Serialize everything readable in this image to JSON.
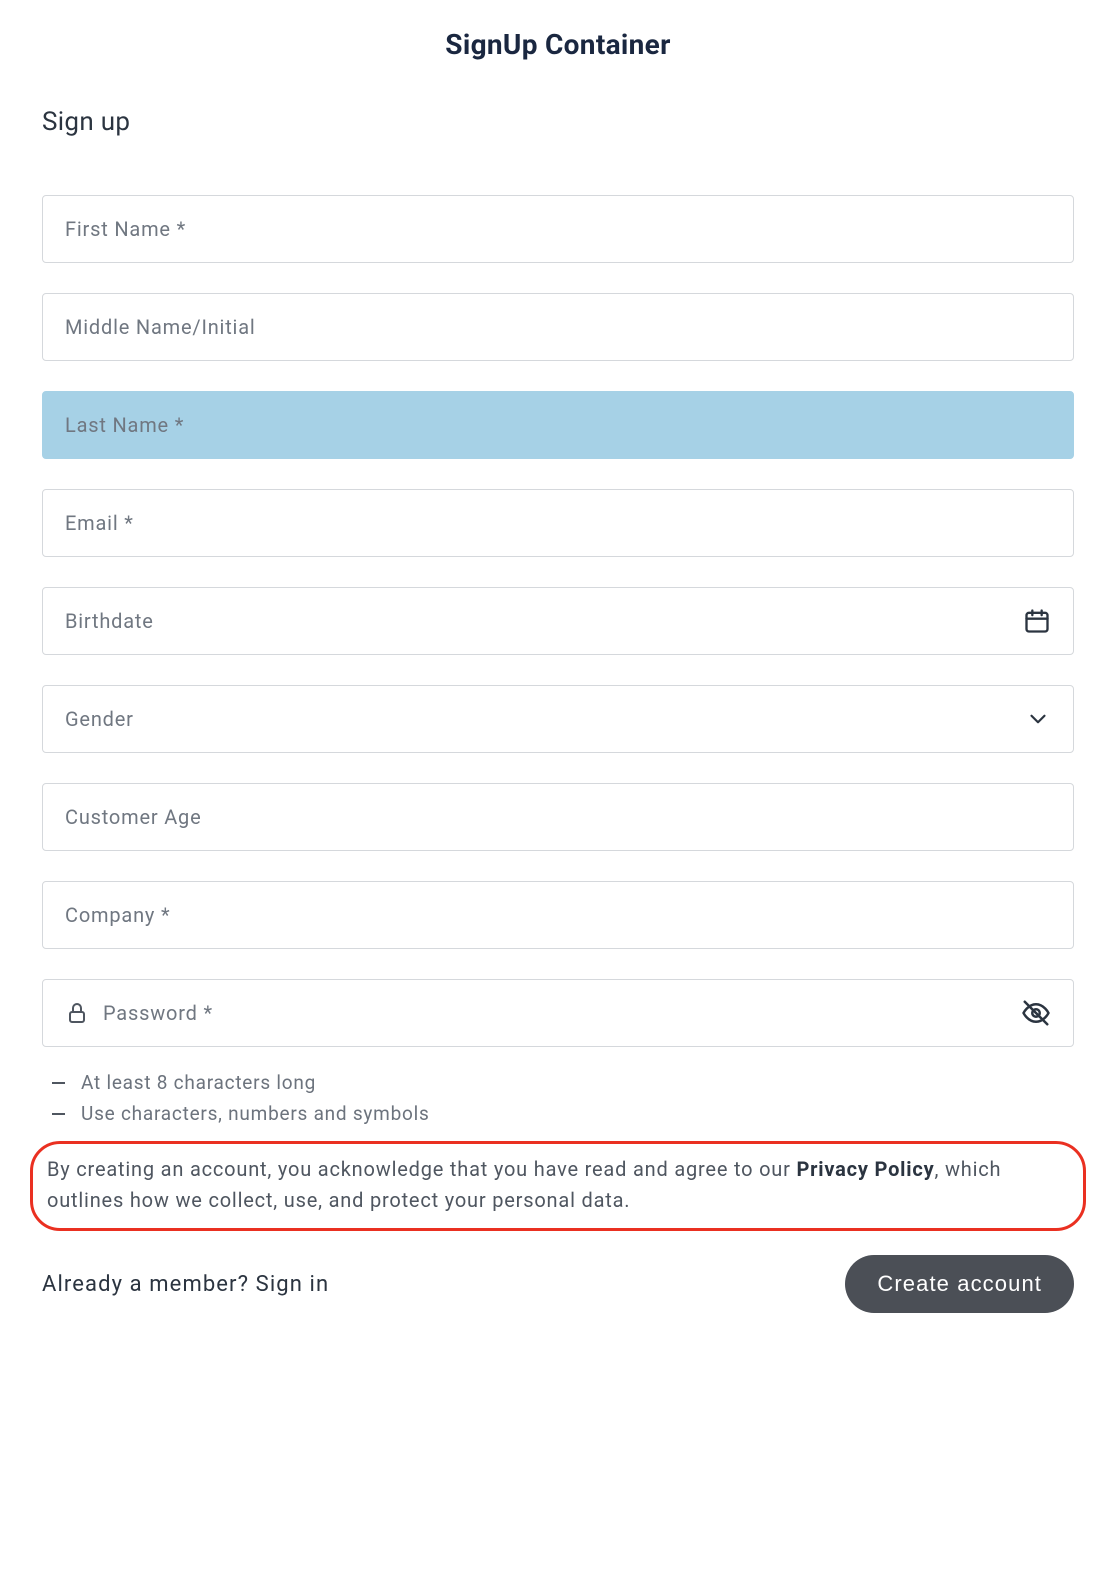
{
  "page": {
    "title": "SignUp Container",
    "heading": "Sign up"
  },
  "fields": {
    "first_name": {
      "placeholder": "First Name *"
    },
    "middle_name": {
      "placeholder": "Middle Name/Initial"
    },
    "last_name": {
      "placeholder": "Last Name *"
    },
    "email": {
      "placeholder": "Email *"
    },
    "birthdate": {
      "placeholder": "Birthdate"
    },
    "gender": {
      "placeholder": "Gender"
    },
    "customer_age": {
      "placeholder": "Customer Age"
    },
    "company": {
      "placeholder": "Company *"
    },
    "password": {
      "placeholder": "Password *"
    }
  },
  "password_hints": [
    "At least 8 characters long",
    "Use characters, numbers and symbols"
  ],
  "privacy": {
    "prefix": "By creating an account, you acknowledge that you have read and agree to our ",
    "link_label": "Privacy Policy",
    "suffix": ", which outlines how we collect, use, and protect your personal data."
  },
  "footer": {
    "signin_prompt": "Already a member? Sign in",
    "create_label": "Create account"
  }
}
